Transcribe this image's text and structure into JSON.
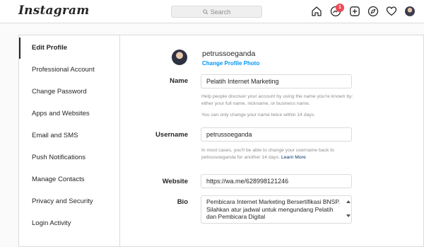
{
  "header": {
    "logo": "Instagram",
    "search_placeholder": "Search",
    "notification_count": "1",
    "icons": [
      "home-icon",
      "messenger-icon",
      "new-post-icon",
      "explore-icon",
      "heart-icon",
      "avatar"
    ]
  },
  "sidebar": {
    "items": [
      {
        "label": "Edit Profile",
        "active": true
      },
      {
        "label": "Professional Account"
      },
      {
        "label": "Change Password"
      },
      {
        "label": "Apps and Websites"
      },
      {
        "label": "Email and SMS"
      },
      {
        "label": "Push Notifications"
      },
      {
        "label": "Manage Contacts"
      },
      {
        "label": "Privacy and Security"
      },
      {
        "label": "Login Activity"
      }
    ]
  },
  "profile": {
    "username": "petrussoeganda",
    "change_photo": "Change Profile Photo"
  },
  "form": {
    "name_label": "Name",
    "name_value": "Pelatih Internet Marketing",
    "name_help_1": "Help people discover your account by using the name you're known by: either your full name, nickname, or business name.",
    "name_help_2": "You can only change your name twice within 14 days.",
    "username_label": "Username",
    "username_value": "petrussoeganda",
    "username_help": "In most cases, you'll be able to change your username back to petrussoeganda for another 14 days.",
    "username_help_link": "Learn More",
    "website_label": "Website",
    "website_value": "https://wa.me/628998121246",
    "bio_label": "Bio",
    "bio_value": "Pembicara Internet Marketing Bersertifikasi BNSP. Silahkan atur jadwal untuk mengundang Pelatih dan Pembicara Digital"
  },
  "colors": {
    "accent": "#0095f6",
    "badge": "#ed4956",
    "border": "#dbdbdb"
  }
}
